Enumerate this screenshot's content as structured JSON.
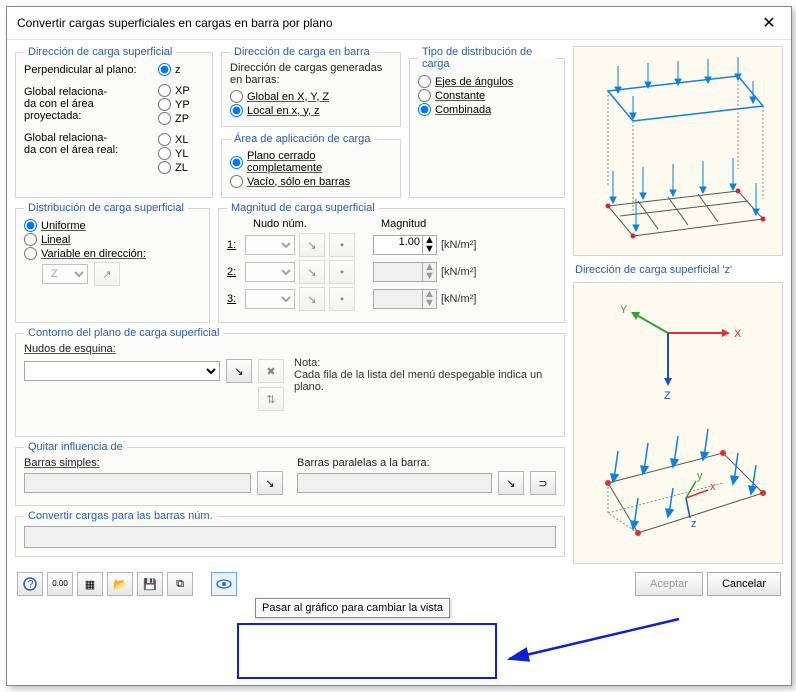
{
  "window": {
    "title": "Convertir cargas superficiales en cargas en barra por plano"
  },
  "groups": {
    "dir_surface": "Dirección de carga superficial",
    "dir_member": "Dirección de carga en barra",
    "dir_member_sub": "Dirección de cargas generadas en barras:",
    "dist_type": "Tipo de distribución de carga",
    "app_area": "Área de aplicación de carga",
    "dist_surface": "Distribución de carga superficial",
    "magnitude": "Magnitud de carga superficial",
    "contour": "Contorno del plano de carga superficial",
    "remove": "Quitar influencia de",
    "convert": "Convertir cargas para las barras núm.",
    "preview": "Dirección de carga superficial 'z'"
  },
  "dir_surface": {
    "perp": "Perpendicular al plano:",
    "proj": "Global relaciona-\nda con el área proyectada:",
    "real": "Global relaciona-\nda con el área real:",
    "opts": {
      "z": "z",
      "XP": "XP",
      "YP": "YP",
      "ZP": "ZP",
      "XL": "XL",
      "YL": "YL",
      "ZL": "ZL"
    }
  },
  "dir_member": {
    "global": "Global en X, Y, Z",
    "local": "Local en x, y, z"
  },
  "dist_type": {
    "axes": "Ejes de ángulos",
    "const": "Constante",
    "comb": "Combinada"
  },
  "app_area": {
    "closed": "Plano cerrado completamente",
    "void": "Vacío, sólo en barras"
  },
  "dist_surface": {
    "uniform": "Uniforme",
    "linear": "Lineal",
    "variable": "Variable en dirección:",
    "axis_opts": "Z"
  },
  "magnitude": {
    "node_col": "Nudo núm.",
    "mag_col": "Magnitud",
    "rows": [
      {
        "label": "1:",
        "value": "1.00",
        "unit": "[kN/m²]"
      },
      {
        "label": "2:",
        "value": "",
        "unit": "[kN/m²]"
      },
      {
        "label": "3:",
        "value": "",
        "unit": "[kN/m²]"
      }
    ]
  },
  "contour": {
    "corner_label": "Nudos de esquina:",
    "note_title": "Nota:",
    "note_text": "Cada fila de la lista del menú despegable indica un plano."
  },
  "remove": {
    "simple": "Barras simples:",
    "parallel": "Barras paralelas a la barra:"
  },
  "buttons": {
    "ok": "Aceptar",
    "cancel": "Cancelar"
  },
  "tooltip": "Pasar al gráfico para cambiar la vista",
  "axes": {
    "x": "X",
    "y": "Y",
    "z": "Z"
  }
}
